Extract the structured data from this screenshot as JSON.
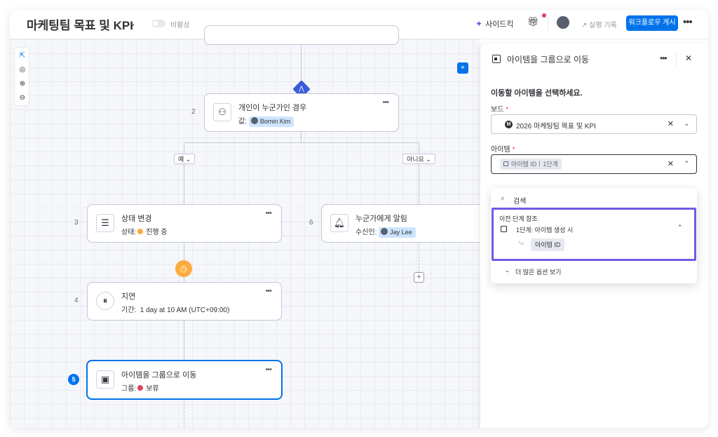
{
  "header": {
    "title": "마케팅팀 목표 및 KPI",
    "visibility_label": "비활성",
    "sidekick_label": "사이드킥",
    "run_log_label": "실행 기록",
    "publish_label": "워크플로우 게시"
  },
  "canvas": {
    "nodes": [
      {
        "number": "2",
        "title": "개인이 누군가인 경우",
        "sub_label": "값:",
        "sub_value": "Bomin Kim"
      },
      {
        "number": "3",
        "title": "상태 변경",
        "sub_label": "상태:",
        "sub_value": "진행 중",
        "status_color": "#fdab3d"
      },
      {
        "number": "6",
        "title": "누군가에게 알림",
        "sub_label": "수신인:",
        "sub_value": "Jay Lee"
      },
      {
        "number": "4",
        "title": "지연",
        "sub_label": "기간:",
        "sub_value": "1 day at 10 AM (UTC+09:00)"
      },
      {
        "number": "5",
        "title": "아이템을 그룹으로 이동",
        "sub_label": "그룹:",
        "sub_value": "보류",
        "status_color": "#e2445c"
      }
    ],
    "branches": {
      "yes": "예",
      "no": "아니요"
    }
  },
  "panel": {
    "title": "아이템을 그룹으로 이동",
    "heading": "이동할 아이템을 선택하세요.",
    "board_label": "보드",
    "board_value": "2026 마케팅팀 목표 및 KPI",
    "item_label": "아이템",
    "item_tag": "아이템 ID",
    "item_tag_step": "1단계",
    "required_mark": "*",
    "dropdown": {
      "search": "검색",
      "group_title": "이전 단계 참조",
      "step_label": "1단계: 아이템 생성 시",
      "item_label": "아이템 ID",
      "more_label": "더 많은 옵션 보기"
    }
  },
  "colors": {
    "accent": "#0073ea",
    "highlight": "#6c5ce7",
    "warning": "#fdab3d",
    "stuck": "#e2445c"
  },
  "icons": [
    "sparkle-icon",
    "gift-icon",
    "graph-icon",
    "more-icon",
    "pointer-icon",
    "focus-icon",
    "zoom-in-icon",
    "zoom-out-icon",
    "person-icon",
    "status-icon",
    "bell-icon",
    "pause-icon",
    "group-move-icon",
    "clock-icon",
    "plus-icon",
    "target-icon",
    "search-icon",
    "close-icon",
    "chevron-down-icon",
    "chevron-up-icon"
  ]
}
